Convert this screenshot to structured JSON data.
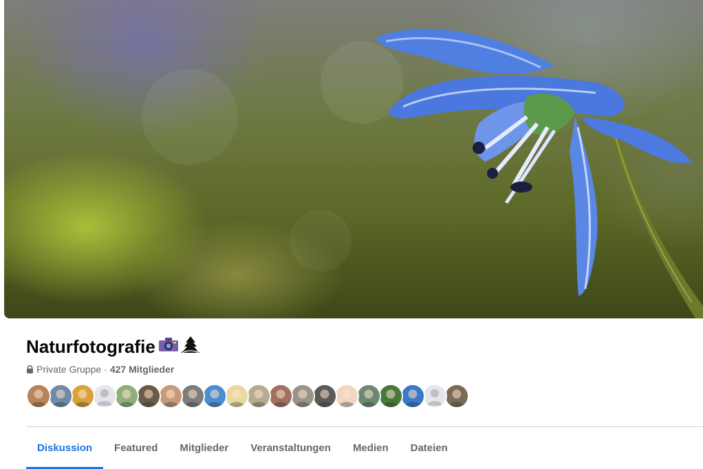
{
  "group": {
    "name": "Naturfotografie",
    "title_icons": [
      "camera-icon",
      "landscape-icon"
    ],
    "privacy_label": "Private Gruppe",
    "separator": "·",
    "members_label": "427 Mitglieder"
  },
  "member_avatars": [
    {
      "icon": "member-avatar",
      "bg": "#b8845a"
    },
    {
      "icon": "member-avatar",
      "bg": "#6f8ba8"
    },
    {
      "icon": "member-avatar",
      "bg": "#d8a33a"
    },
    {
      "icon": "default-avatar",
      "bg": "#dcdfe3"
    },
    {
      "icon": "member-avatar",
      "bg": "#8fb07a"
    },
    {
      "icon": "member-avatar",
      "bg": "#6a5a48"
    },
    {
      "icon": "member-avatar",
      "bg": "#c79a7a"
    },
    {
      "icon": "member-avatar",
      "bg": "#7d7d7d"
    },
    {
      "icon": "member-avatar",
      "bg": "#4b8fd0"
    },
    {
      "icon": "member-avatar",
      "bg": "#e8d9a0"
    },
    {
      "icon": "member-avatar",
      "bg": "#b5aa92"
    },
    {
      "icon": "member-avatar",
      "bg": "#a07060"
    },
    {
      "icon": "member-avatar",
      "bg": "#9a9488"
    },
    {
      "icon": "member-avatar",
      "bg": "#5a5a5a"
    },
    {
      "icon": "member-avatar",
      "bg": "#f0d8c0"
    },
    {
      "icon": "member-avatar",
      "bg": "#6a8a70"
    },
    {
      "icon": "member-avatar",
      "bg": "#4a7a3a"
    },
    {
      "icon": "member-avatar",
      "bg": "#3a78c8"
    },
    {
      "icon": "default-avatar",
      "bg": "#dcdfe3"
    },
    {
      "icon": "member-avatar",
      "bg": "#7a6a58"
    }
  ],
  "tabs": [
    {
      "label": "Diskussion",
      "active": true
    },
    {
      "label": "Featured",
      "active": false
    },
    {
      "label": "Mitglieder",
      "active": false
    },
    {
      "label": "Veranstaltungen",
      "active": false
    },
    {
      "label": "Medien",
      "active": false
    },
    {
      "label": "Dateien",
      "active": false
    }
  ],
  "colors": {
    "accent": "#1b74e4",
    "text_primary": "#050505",
    "text_secondary": "#65676b",
    "divider": "#ced0d4"
  }
}
